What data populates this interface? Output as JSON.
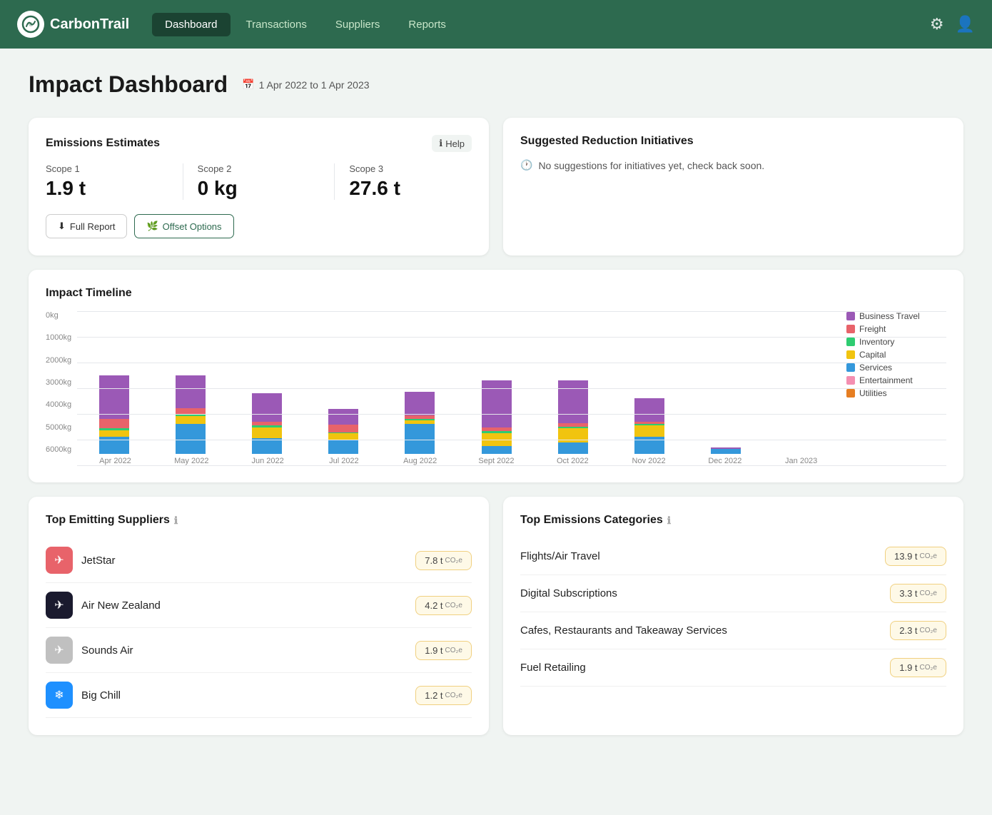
{
  "nav": {
    "brand": "CarbonTrail",
    "links": [
      {
        "label": "Dashboard",
        "active": true
      },
      {
        "label": "Transactions",
        "active": false
      },
      {
        "label": "Suppliers",
        "active": false
      },
      {
        "label": "Reports",
        "active": false
      }
    ]
  },
  "page": {
    "title": "Impact Dashboard",
    "date_range": "1 Apr 2022  to  1 Apr 2023"
  },
  "emissions": {
    "card_title": "Emissions Estimates",
    "help_label": "Help",
    "scope1_label": "Scope 1",
    "scope1_value": "1.9 t",
    "scope2_label": "Scope 2",
    "scope2_value": "0 kg",
    "scope3_label": "Scope 3",
    "scope3_value": "27.6 t",
    "btn_report": "Full Report",
    "btn_offset": "Offset Options"
  },
  "suggestions": {
    "card_title": "Suggested Reduction Initiatives",
    "message": "No suggestions for initiatives yet, check back soon."
  },
  "timeline": {
    "title": "Impact Timeline",
    "y_labels": [
      "0kg",
      "1000kg",
      "2000kg",
      "3000kg",
      "4000kg",
      "5000kg",
      "6000kg"
    ],
    "x_labels": [
      "Apr 2022",
      "May 2022",
      "Jun 2022",
      "Jul 2022",
      "Aug 2022",
      "Sept 2022",
      "Oct 2022",
      "Nov 2022",
      "Dec 2022",
      "Jan 2023"
    ],
    "legend": [
      {
        "label": "Business Travel",
        "color": "#9b59b6"
      },
      {
        "label": "Freight",
        "color": "#e8636a"
      },
      {
        "label": "Inventory",
        "color": "#2ecc71"
      },
      {
        "label": "Capital",
        "color": "#f1c40f"
      },
      {
        "label": "Services",
        "color": "#3498db"
      },
      {
        "label": "Entertainment",
        "color": "#f48fb1"
      },
      {
        "label": "Utilities",
        "color": "#e67e22"
      }
    ],
    "bars": [
      {
        "month": "Apr 2022",
        "purple": 55,
        "red": 12,
        "green": 3,
        "yellow": 8,
        "blue": 22,
        "pink": 0,
        "orange": 0
      },
      {
        "month": "May 2022",
        "purple": 42,
        "red": 8,
        "green": 2,
        "yellow": 10,
        "blue": 38,
        "pink": 0,
        "orange": 0
      },
      {
        "month": "Jun 2022",
        "purple": 36,
        "red": 5,
        "green": 2,
        "yellow": 14,
        "blue": 20,
        "pink": 0,
        "orange": 0
      },
      {
        "month": "Jul 2022",
        "purple": 20,
        "red": 10,
        "green": 1,
        "yellow": 8,
        "blue": 18,
        "pink": 0,
        "orange": 0
      },
      {
        "month": "Aug 2022",
        "purple": 30,
        "red": 4,
        "green": 2,
        "yellow": 5,
        "blue": 38,
        "pink": 0,
        "orange": 0
      },
      {
        "month": "Sept 2022",
        "purple": 60,
        "red": 5,
        "green": 3,
        "yellow": 16,
        "blue": 10,
        "pink": 0,
        "orange": 0
      },
      {
        "month": "Oct 2022",
        "purple": 55,
        "red": 4,
        "green": 2,
        "yellow": 18,
        "blue": 15,
        "pink": 0,
        "orange": 0
      },
      {
        "month": "Nov 2022",
        "purple": 30,
        "red": 3,
        "green": 2,
        "yellow": 14,
        "blue": 22,
        "pink": 0,
        "orange": 0
      },
      {
        "month": "Dec 2022",
        "purple": 2,
        "red": 0,
        "green": 0,
        "yellow": 0,
        "blue": 6,
        "pink": 0,
        "orange": 0
      },
      {
        "month": "Jan 2023",
        "purple": 0,
        "red": 0,
        "green": 0,
        "yellow": 0,
        "blue": 0,
        "pink": 0,
        "orange": 0
      }
    ]
  },
  "suppliers": {
    "title": "Top Emitting Suppliers",
    "items": [
      {
        "name": "JetStar",
        "value": "7.8 t",
        "logo_bg": "#e8636a",
        "logo_text": "✈"
      },
      {
        "name": "Air New Zealand",
        "value": "4.2 t",
        "logo_bg": "#f0f0f0",
        "logo_text": "✈"
      },
      {
        "name": "Sounds Air",
        "value": "1.9 t",
        "logo_bg": "#f0f0f0",
        "logo_text": "✈"
      },
      {
        "name": "Big Chill",
        "value": "1.2 t",
        "logo_bg": "#f0f0f0",
        "logo_text": "❄"
      }
    ]
  },
  "categories": {
    "title": "Top Emissions Categories",
    "items": [
      {
        "name": "Flights/Air Travel",
        "value": "13.9 t"
      },
      {
        "name": "Digital Subscriptions",
        "value": "3.3 t"
      },
      {
        "name": "Cafes, Restaurants and Takeaway Services",
        "value": "2.3 t"
      },
      {
        "name": "Fuel Retailing",
        "value": "1.9 t"
      }
    ]
  }
}
